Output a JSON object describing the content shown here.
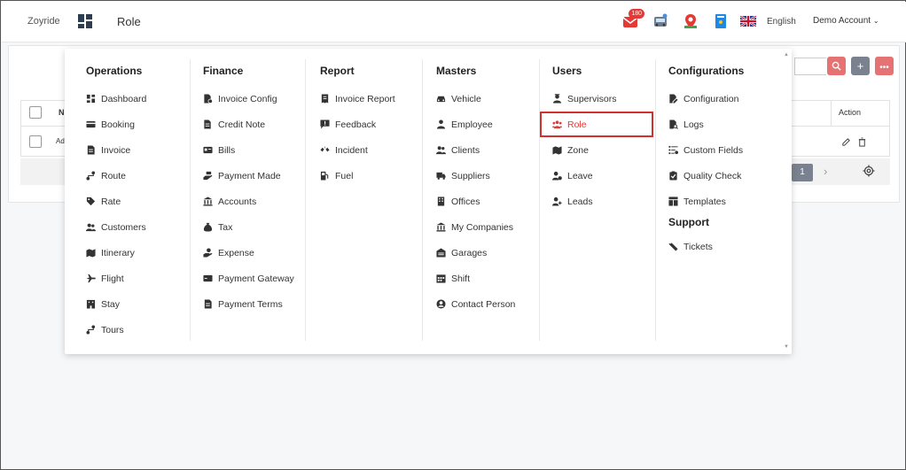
{
  "topbar": {
    "brand": "Zoyride",
    "page_title": "Role",
    "notifications_count": "180",
    "language": "English",
    "account": "Demo Account"
  },
  "table": {
    "action_header": "Action",
    "first_header_initial": "N",
    "first_cell_partial": "Ad",
    "current_page": "1"
  },
  "menu": {
    "columns": [
      {
        "title": "Operations",
        "items": [
          "Dashboard",
          "Booking",
          "Invoice",
          "Route",
          "Rate",
          "Customers",
          "Itinerary",
          "Flight",
          "Stay",
          "Tours"
        ]
      },
      {
        "title": "Finance",
        "items": [
          "Invoice Config",
          "Credit Note",
          "Bills",
          "Payment Made",
          "Accounts",
          "Tax",
          "Expense",
          "Payment Gateway",
          "Payment Terms"
        ]
      },
      {
        "title": "Report",
        "items": [
          "Invoice Report",
          "Feedback",
          "Incident",
          "Fuel"
        ]
      },
      {
        "title": "Masters",
        "items": [
          "Vehicle",
          "Employee",
          "Clients",
          "Suppliers",
          "Offices",
          "My Companies",
          "Garages",
          "Shift",
          "Contact Person"
        ]
      },
      {
        "title": "Users",
        "items": [
          "Supervisors",
          "Role",
          "Zone",
          "Leave",
          "Leads"
        ],
        "active": "Role"
      },
      {
        "title": "Configurations",
        "items": [
          "Configuration",
          "Logs",
          "Custom Fields",
          "Quality Check",
          "Templates"
        ],
        "sub_title": "Support",
        "sub_items": [
          "Tickets"
        ]
      }
    ]
  },
  "colors": {
    "accent": "#e53935",
    "primary_dark": "#2c3e50",
    "button_gray": "#7a8290"
  }
}
